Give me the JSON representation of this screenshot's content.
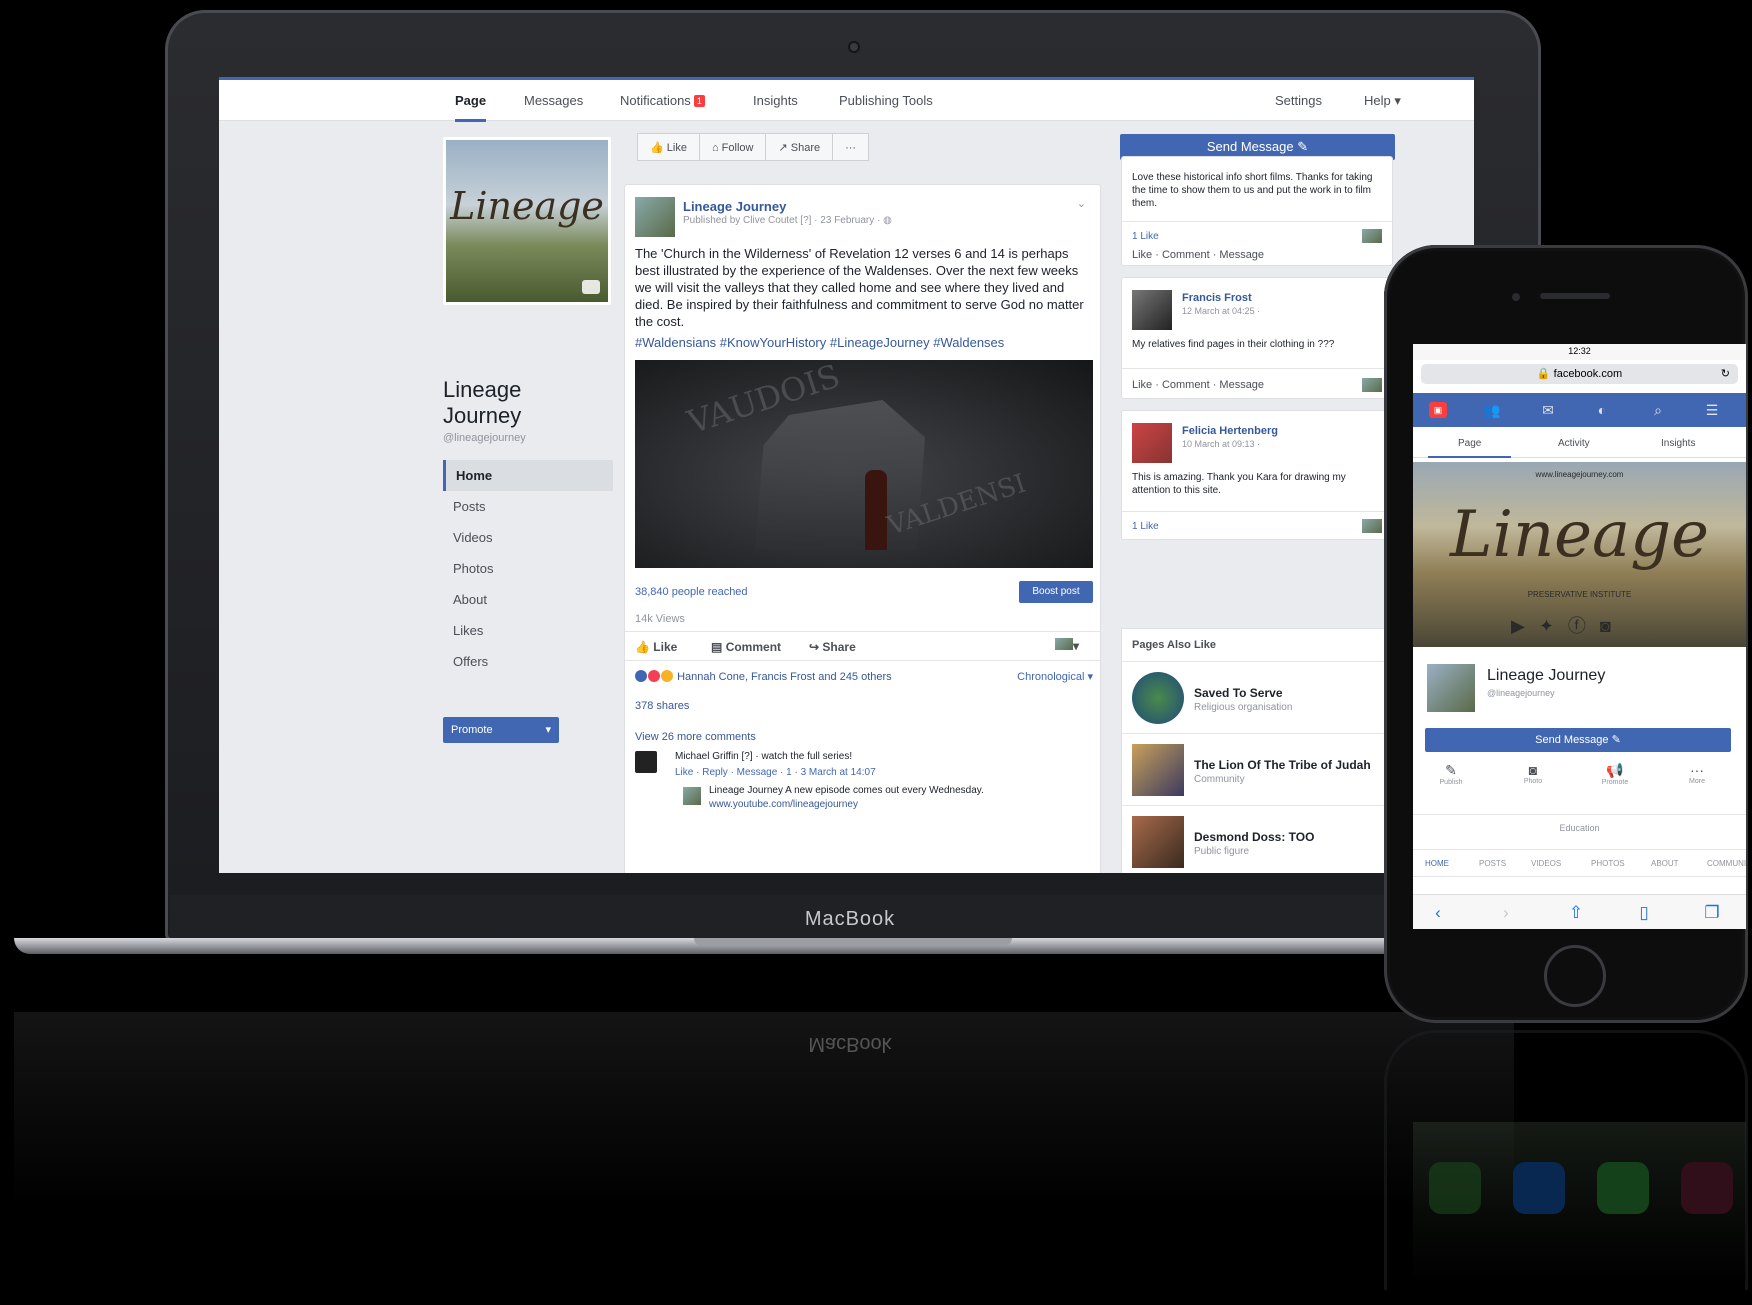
{
  "laptop": {
    "brand": "MacBook"
  },
  "desktop": {
    "tabs": [
      "Page",
      "Messages",
      "Notifications",
      "Insights",
      "Publishing Tools"
    ],
    "notifications_badge": "1",
    "right_tabs": [
      "Settings",
      "Help ▾"
    ],
    "left": {
      "cover_word": "Lineage",
      "page_name": "Lineage Journey",
      "page_handle": "@lineagejourney",
      "nav": [
        "Home",
        "Posts",
        "Videos",
        "Photos",
        "About",
        "Likes",
        "Offers"
      ],
      "promote": "Promote"
    },
    "actions": [
      "Like",
      "Follow",
      "Share",
      "···"
    ],
    "send_message": "Send Message",
    "post": {
      "author": "Lineage Journey",
      "meta": "Published by Clive Coutet [?] · 23 February · ",
      "text": "The 'Church in the Wilderness' of Revelation 12 verses 6 and 14 is perhaps best illustrated by the experience of the Waldenses. Over the next few weeks we will visit the valleys that they called home and see where they lived and died. Be inspired by their faithfulness and commitment to serve God no matter the cost.",
      "tags": "#Waldensians #KnowYourHistory #LineageJourney #Waldenses",
      "image_watermark_1": "VAUDOIS",
      "image_watermark_2": "VALDENSI",
      "reach": "38,840 people reached",
      "boost": "Boost post",
      "views": "14k Views",
      "actions": [
        "Like",
        "Comment",
        "Share"
      ],
      "reactions": "Hannah Cone, Francis Frost and 245 others",
      "order": "Chronological ▾",
      "shares": "378 shares",
      "view_more": "View 26 more comments",
      "comment_text": "Michael Griffin [?] · watch the full series!",
      "comment_meta": "Like · Reply · Message · 1 · 3 March at 14:07",
      "reply_text": "Lineage Journey A new episode comes out every Wednesday.",
      "reply_link": "www.youtube.com/lineagejourney"
    },
    "right": {
      "card1_text": "Love these historical info short films. Thanks for taking the time to show them to us and put the work in to film them.",
      "card1_likes": "1 Like",
      "card_actions": "Like · Comment · Message",
      "card2_name": "Francis Frost",
      "card2_date": "12 March at 04:25 ·",
      "card2_text": "My relatives find pages in their clothing in ???",
      "card3_name": "Felicia Hertenberg",
      "card3_date": "10 March at 09:13 ·",
      "card3_text": "This is amazing. Thank you Kara for drawing my attention to this site.",
      "card3_likes": "1 Like",
      "pal_title": "Pages Also Like",
      "pal": [
        {
          "name": "Saved To Serve",
          "sub": "Religious organisation"
        },
        {
          "name": "The Lion Of The Tribe of Judah",
          "sub": "Community"
        },
        {
          "name": "Desmond Doss: TOO",
          "sub": "Public figure"
        }
      ]
    }
  },
  "phone": {
    "time": "12:32",
    "url": "facebook.com",
    "tabs": [
      "Page",
      "Activity",
      "Insights"
    ],
    "cover_url": "www.lineagejourney.com",
    "cover_word": "Lineage",
    "cover_sub": "PRESERVATIVE INSTITUTE",
    "page_name": "Lineage Journey",
    "page_handle": "@lineagejourney",
    "send_message": "Send Message",
    "acts": [
      "Publish",
      "Photo",
      "Promote",
      "More"
    ],
    "edu": "Education",
    "subtabs": [
      "HOME",
      "POSTS",
      "VIDEOS",
      "PHOTOS",
      "ABOUT",
      "COMMUNITY"
    ]
  },
  "colors": {
    "brand_blue": "#4267b2",
    "link_blue": "#365899",
    "fb_bg": "#e9ebee"
  }
}
